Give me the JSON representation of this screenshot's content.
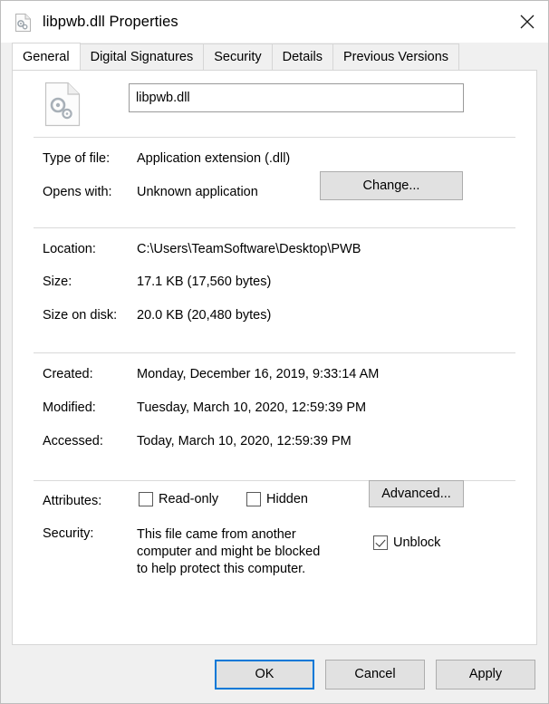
{
  "window": {
    "title": "libpwb.dll Properties",
    "icon": "dll-file-icon",
    "close_label": "✕"
  },
  "tabs": [
    {
      "label": "General",
      "active": true
    },
    {
      "label": "Digital Signatures",
      "active": false
    },
    {
      "label": "Security",
      "active": false
    },
    {
      "label": "Details",
      "active": false
    },
    {
      "label": "Previous Versions",
      "active": false
    }
  ],
  "general": {
    "filename_value": "libpwb.dll",
    "filename_placeholder": "",
    "rows": [
      {
        "label": "Type of file:",
        "value": "Application extension (.dll)"
      },
      {
        "label": "Opens with:",
        "value": "Unknown application"
      },
      {
        "label": "Location:",
        "value": "C:\\Users\\TeamSoftware\\Desktop\\PWB"
      },
      {
        "label": "Size:",
        "value": "17.1 KB (17,560 bytes)"
      },
      {
        "label": "Size on disk:",
        "value": "20.0 KB (20,480 bytes)"
      },
      {
        "label": "Created:",
        "value": "Monday, December 16, 2019, 9:33:14 AM"
      },
      {
        "label": "Modified:",
        "value": "Tuesday, March 10, 2020, 12:59:39 PM"
      },
      {
        "label": "Accessed:",
        "value": "Today, March 10, 2020, 12:59:39 PM"
      },
      {
        "label": "Attributes:",
        "value": ""
      },
      {
        "label": "Security:",
        "value": "This file came from another computer and might be blocked to help protect this computer."
      }
    ],
    "change_button": "Change...",
    "advanced_button": "Advanced...",
    "checkboxes": [
      {
        "label": "Read-only",
        "checked": false
      },
      {
        "label": "Hidden",
        "checked": false
      },
      {
        "label": "Unblock",
        "checked": true
      }
    ]
  },
  "footer": {
    "ok": "OK",
    "cancel": "Cancel",
    "apply": "Apply"
  },
  "colors": {
    "accent": "#0078d7",
    "window_bg": "#f0f0f0",
    "page_bg": "#ffffff",
    "button_bg": "#e1e1e1"
  }
}
